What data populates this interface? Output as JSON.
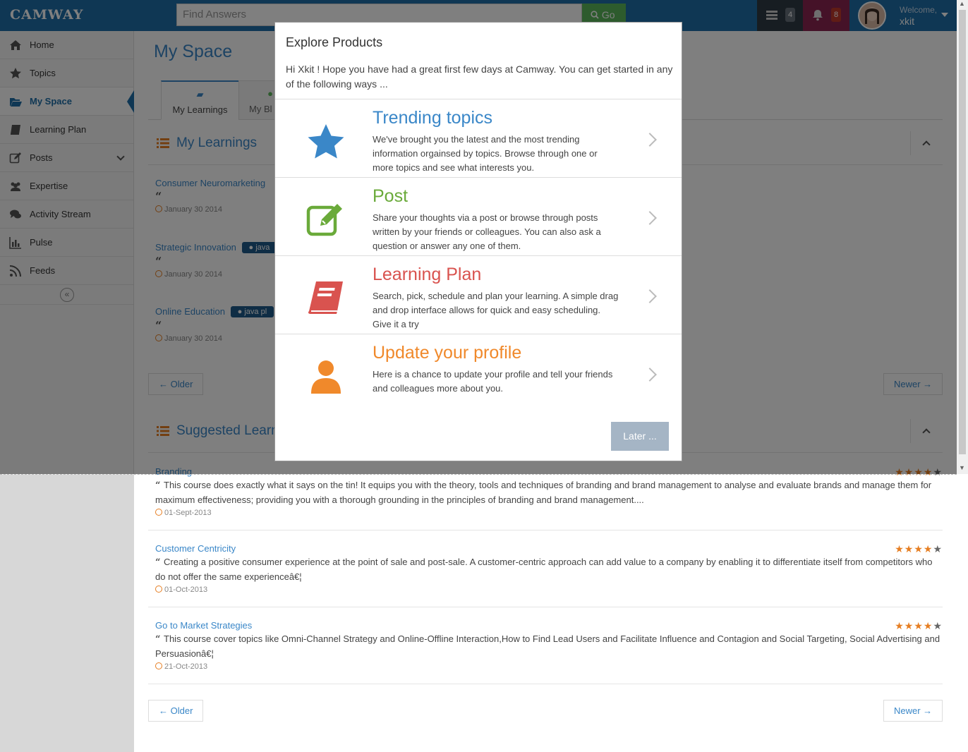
{
  "header": {
    "logo": "CAMWAY",
    "search_placeholder": "Find Answers",
    "go_label": "Go",
    "tasks_count": "4",
    "notifications_count": "8",
    "welcome": "Welcome,",
    "username": "xkit"
  },
  "sidebar": {
    "items": [
      {
        "label": "Home",
        "icon": "home-icon"
      },
      {
        "label": "Topics",
        "icon": "star-icon"
      },
      {
        "label": "My Space",
        "icon": "folder-open-icon"
      },
      {
        "label": "Learning Plan",
        "icon": "book-icon"
      },
      {
        "label": "Posts",
        "icon": "edit-icon"
      },
      {
        "label": "Expertise",
        "icon": "users-icon"
      },
      {
        "label": "Activity Stream",
        "icon": "comments-icon"
      },
      {
        "label": "Pulse",
        "icon": "bar-chart-icon"
      },
      {
        "label": "Feeds",
        "icon": "rss-icon"
      }
    ],
    "collapse_glyph": "«"
  },
  "main": {
    "page_title": "My Space",
    "tabs": [
      {
        "label": "My Learnings"
      },
      {
        "label": "My Bl"
      }
    ],
    "my_learnings": {
      "title": "My Learnings",
      "items": [
        {
          "title": "Consumer Neuromarketing",
          "tag": "",
          "date": "January 30 2014"
        },
        {
          "title": "Strategic Innovation",
          "tag": "java",
          "date": "January 30 2014"
        },
        {
          "title": "Online Education",
          "tag": "java pl",
          "date": "January 30 2014"
        }
      ],
      "older": "← Older",
      "newer": "Newer →"
    },
    "suggested": {
      "title": "Suggested Learni",
      "items": [
        {
          "title": "Branding",
          "desc": "This course does exactly what it says on the tin! It equips you with the theory, tools and techniques of branding and brand management to analyse and evaluate brands and manage them for maximum effectiveness; providing you with a thorough grounding in the principles of branding and brand management....",
          "date": "01-Sept-2013",
          "rating": 4
        },
        {
          "title": "Customer Centricity",
          "desc": "Creating a positive consumer experience at the point of sale and post-sale. A customer-centric approach can add value to a company by enabling it to differentiate itself from competitors who do not offer the same experienceâ€¦",
          "date": "01-Oct-2013",
          "rating": 4
        },
        {
          "title": "Go to Market Strategies",
          "desc": "This course cover topics like Omni-Channel Strategy and Online-Offline Interaction,How to Find Lead Users and Facilitate Influence and Contagion and Social Targeting, Social Advertising and Persuasionâ€¦",
          "date": "21-Oct-2013",
          "rating": 4
        }
      ],
      "older": "← Older",
      "newer": "Newer →"
    }
  },
  "modal": {
    "title": "Explore Products",
    "intro": "Hi Xkit ! Hope you have had a great first few days at Camway. You can get started in any of the following ways ...",
    "options": [
      {
        "title": "Trending topics",
        "desc": "We've brought you the latest and the most trending information orgainsed by topics. Browse through one or more topics and see what interests you.",
        "color": "#3a87c8",
        "icon": "star-icon"
      },
      {
        "title": "Post",
        "desc": "Share your thoughts via a post or browse through posts written by your friends or colleagues. You can also ask a question or answer any one of them.",
        "color": "#6aaa3a",
        "icon": "edit-icon"
      },
      {
        "title": "Learning Plan",
        "desc": "Search, pick, schedule and plan your learning. A simple drag and drop interface allows for quick and easy scheduling. Give it a try",
        "color": "#d9534f",
        "icon": "book-icon"
      },
      {
        "title": "Update your profile",
        "desc": "Here is a chance to update your profile and tell your friends and colleagues more about you.",
        "color": "#f0892b",
        "icon": "user-icon"
      }
    ],
    "later_label": "Later ..."
  }
}
